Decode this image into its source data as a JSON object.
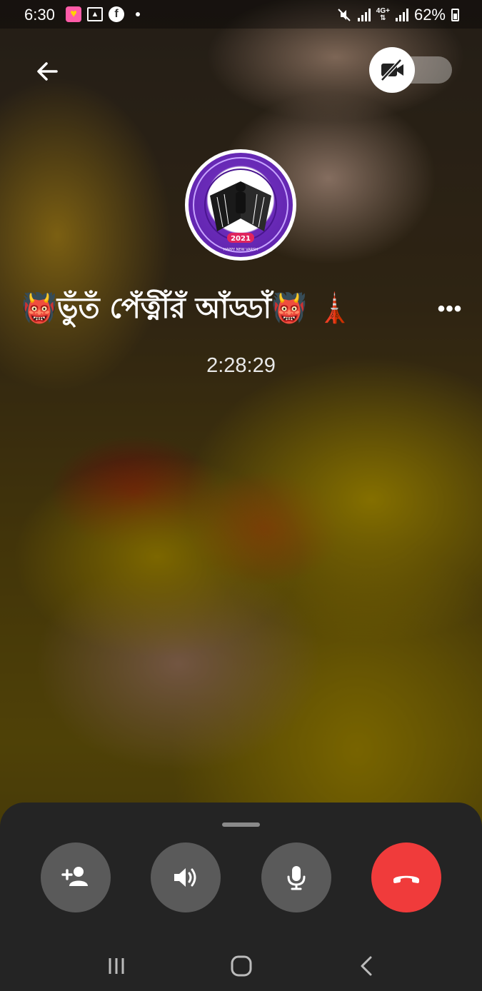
{
  "status_bar": {
    "time": "6:30",
    "network_type": "4G+",
    "battery": "62%"
  },
  "call": {
    "group_name": "👹ভুঁতঁ পেঁত্নীঁরঁ আঁড্ডাঁ👹 🗼",
    "duration": "2:28:29",
    "video_enabled": false
  },
  "avatar": {
    "badge_text": "2021",
    "ring_text": "HAPPY NEW VARSH"
  },
  "icons": {
    "back": "arrow-left-icon",
    "video": "video-off-icon",
    "more": "more-horizontal-icon",
    "add_person": "add-person-icon",
    "speaker": "speaker-icon",
    "mic": "microphone-icon",
    "end_call": "end-call-icon"
  },
  "more_label": "•••",
  "colors": {
    "sheet": "#242424",
    "button": "#5a5a5a",
    "end_call": "#f03b3b",
    "avatar_ring": "#6a2bb8"
  }
}
